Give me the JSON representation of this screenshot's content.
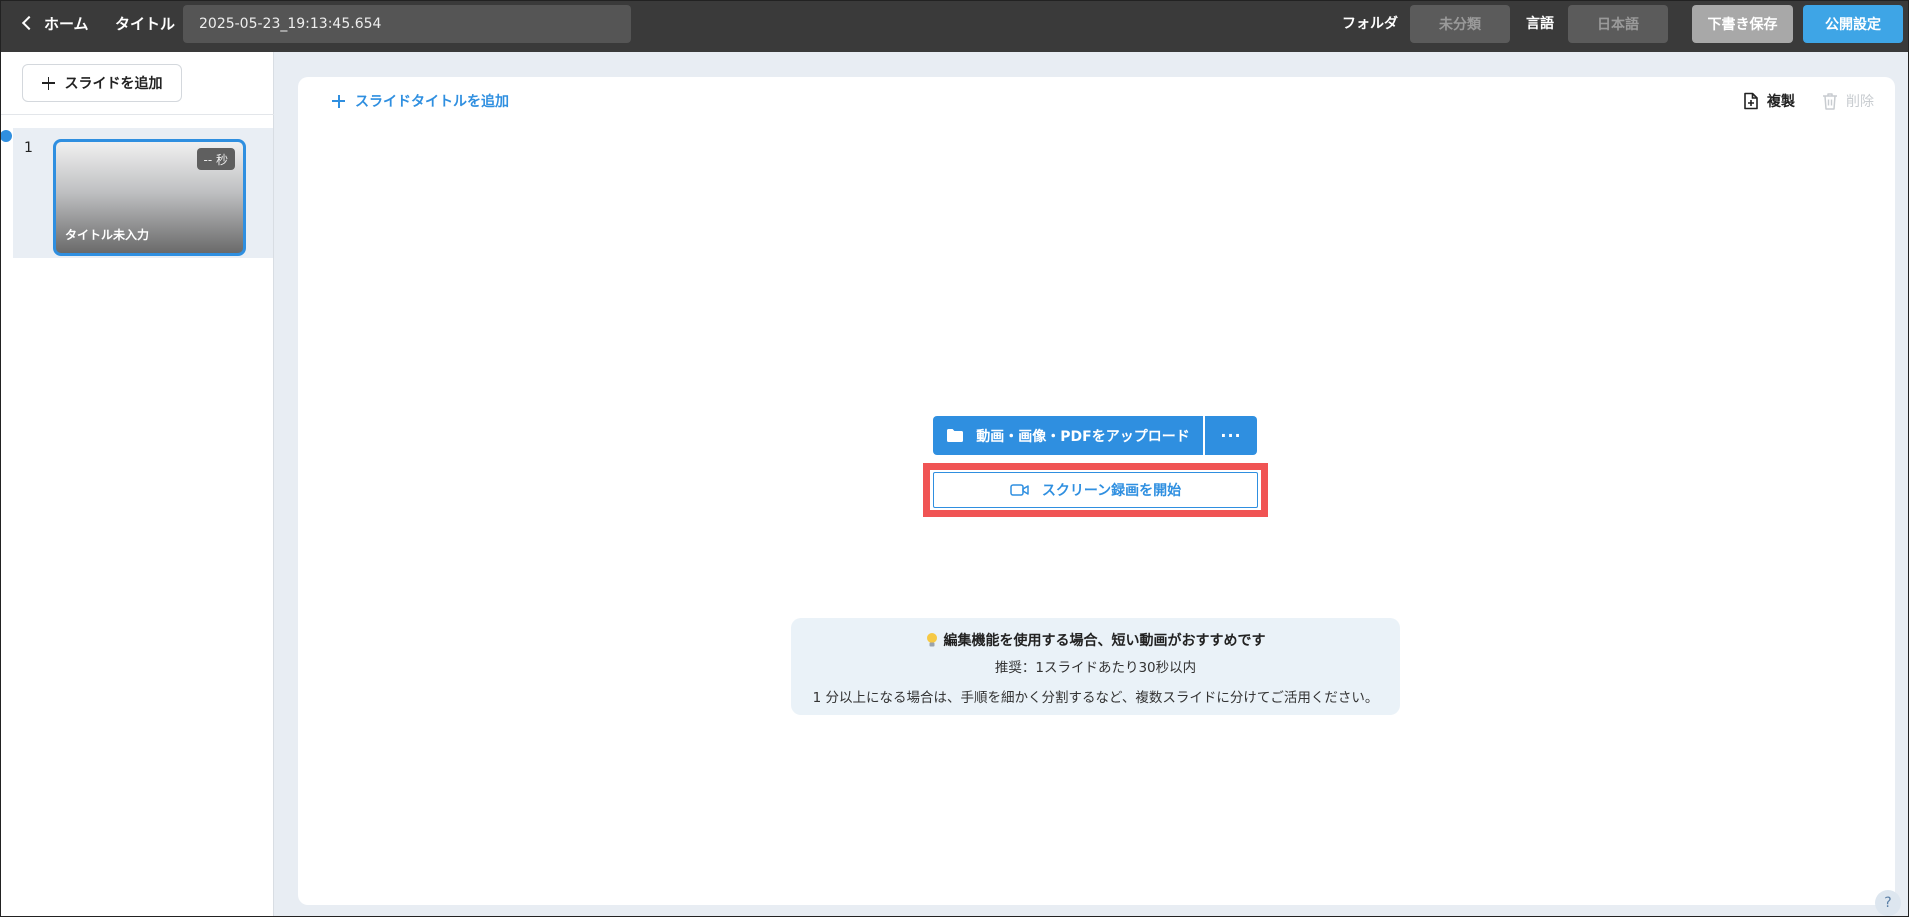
{
  "header": {
    "back_label": "ホーム",
    "title_label": "タイトル",
    "title_value": "2025-05-23_19:13:45.654",
    "folder_label": "フォルダ",
    "folder_value": "未分類",
    "language_label": "言語",
    "language_value": "日本語",
    "draft_button": "下書き保存",
    "publish_button": "公開設定"
  },
  "sidebar": {
    "add_slide_label": "スライドを追加",
    "slides": [
      {
        "number": "1",
        "duration": "-- 秒",
        "title": "タイトル未入力"
      }
    ]
  },
  "editor": {
    "add_title_label": "スライドタイトルを追加",
    "duplicate_label": "複製",
    "delete_label": "削除",
    "upload_label": "動画・画像・PDFをアップロード",
    "more_label": "···",
    "record_label": "スクリーン録画を開始",
    "tip": {
      "heading": "編集機能を使用する場合、短い動画がおすすめです",
      "line1": "推奨：1スライドあたり30秒以内",
      "line2": "1 分以上になる場合は、手順を細かく分割するなど、複数スライドに分けてご活用ください。"
    },
    "help_label": "?"
  },
  "colors": {
    "accent": "#2f8fe0",
    "highlight": "#f05454",
    "header_bg": "#3a3a3a"
  }
}
